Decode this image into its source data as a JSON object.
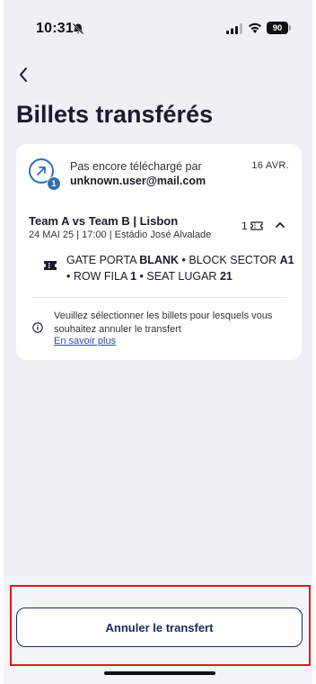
{
  "status_bar": {
    "time": "10:31",
    "battery": "90",
    "icons": [
      "bell-off-icon",
      "signal-icon",
      "wifi-icon",
      "battery-icon"
    ]
  },
  "nav": {
    "back_icon": "chevron-left-icon"
  },
  "page": {
    "title": "Billets transférés"
  },
  "transfer": {
    "count_badge": "1",
    "status": "Pas encore téléchargé par",
    "recipient": "unknown.user@mail.com",
    "date": "16 AVR."
  },
  "event": {
    "title": "Team A vs Team B | Lisbon",
    "details": "24 MAI 25 | 17:00 | Estádio José Alvalade",
    "ticket_count": "1"
  },
  "seat": {
    "gate_label": "GATE PORTA",
    "gate_value": "BLANK",
    "block_label": "BLOCK SECTOR",
    "block_value": "A1",
    "row_label": "ROW FILA",
    "row_value": "1",
    "seat_label": "SEAT LUGAR",
    "seat_value": "21",
    "separator": "•"
  },
  "info": {
    "message": "Veuillez sélectionner les billets pour lesquels vous souhaitez annuler le transfert",
    "link": "En savoir plus"
  },
  "actions": {
    "cancel_transfer": "Annuler le transfert"
  },
  "colors": {
    "accent": "#2f6fb5",
    "button_border": "#1b2a5e",
    "highlight": "#e0191e",
    "background": "#eef0f5"
  }
}
